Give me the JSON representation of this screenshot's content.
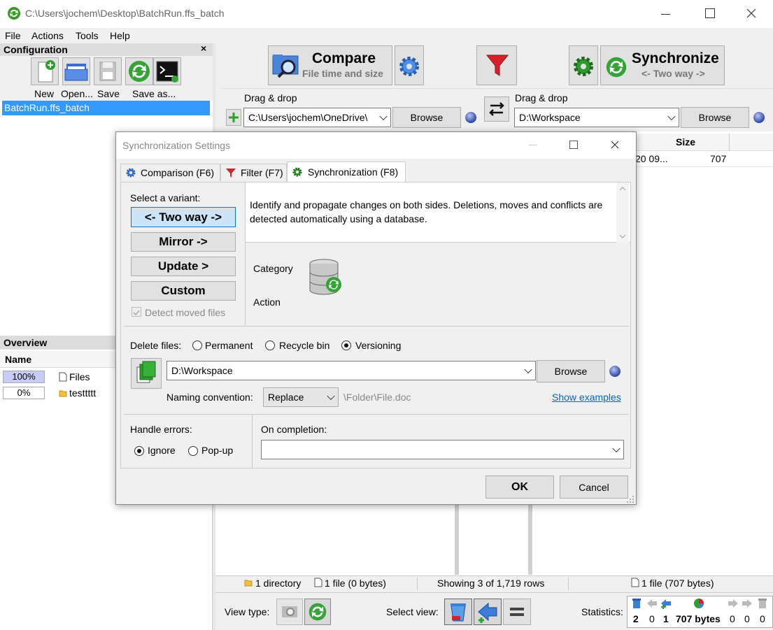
{
  "window": {
    "title": "C:\\Users\\jochem\\Desktop\\BatchRun.ffs_batch"
  },
  "menu": [
    "File",
    "Actions",
    "Tools",
    "Help"
  ],
  "config_panel": {
    "title": "Configuration",
    "buttons": [
      "New",
      "Open...",
      "Save",
      "Save as..."
    ],
    "items": [
      "BatchRun.ffs_batch"
    ]
  },
  "overview_panel": {
    "title": "Overview",
    "col_name": "Name",
    "rows": [
      {
        "pct": "100%",
        "name": "Files"
      },
      {
        "pct": "0%",
        "name": "testtttt"
      }
    ]
  },
  "toolbar": {
    "compare_title": "Compare",
    "compare_sub": "File time and size",
    "sync_title": "Synchronize",
    "sync_sub": "<- Two way ->"
  },
  "folders": {
    "left_label": "Drag & drop",
    "right_label": "Drag & drop",
    "left_path": "C:\\Users\\jochem\\OneDrive\\",
    "right_path": "D:\\Workspace",
    "browse": "Browse"
  },
  "grid": {
    "col_size": "Size",
    "row_date": "20 09...",
    "row_size": "707"
  },
  "statusbar": {
    "left_dirs": "1 directory",
    "left_files": "1 file (0 bytes)",
    "showing": "Showing 3 of 1,719 rows",
    "right_files": "1 file (707 bytes)"
  },
  "bottombar": {
    "view_type": "View type:",
    "select_view": "Select view:",
    "statistics": "Statistics:",
    "stats": [
      "2",
      "0",
      "1",
      "707 bytes",
      "0",
      "0",
      "0"
    ]
  },
  "dialog": {
    "title": "Synchronization Settings",
    "tabs": [
      "Comparison (F6)",
      "Filter (F7)",
      "Synchronization (F8)"
    ],
    "select_variant": "Select a variant:",
    "variants": [
      "<- Two way ->",
      "Mirror ->",
      "Update >",
      "Custom"
    ],
    "detect_moved": "Detect moved files",
    "description": "Identify and propagate changes on both sides. Deletions, moves and conflicts are detected automatically using a database.",
    "category": "Category",
    "action": "Action",
    "delete_files": "Delete files:",
    "delete_options": [
      "Permanent",
      "Recycle bin",
      "Versioning"
    ],
    "versioning_path": "D:\\Workspace",
    "browse": "Browse",
    "naming_label": "Naming convention:",
    "naming_value": "Replace",
    "naming_example": "\\Folder\\File.doc",
    "show_examples": "Show examples",
    "handle_errors": "Handle errors:",
    "error_options": [
      "Ignore",
      "Pop-up"
    ],
    "on_completion": "On completion:",
    "on_completion_value": "",
    "ok": "OK",
    "cancel": "Cancel"
  }
}
